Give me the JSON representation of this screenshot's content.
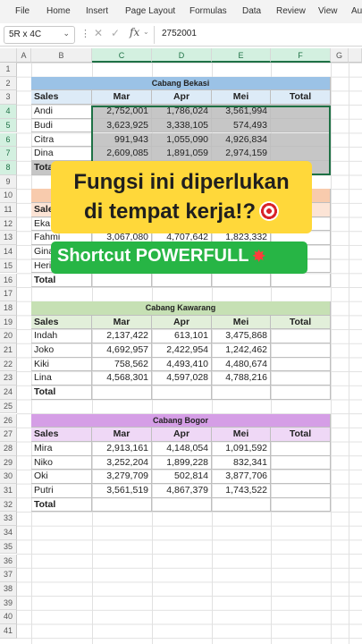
{
  "ribbon": {
    "tabs": [
      "File",
      "Home",
      "Insert",
      "Page Layout",
      "Formulas",
      "Data",
      "Review",
      "View",
      "Au"
    ]
  },
  "formula_bar": {
    "name_box": "5R x 4C",
    "fx": "fx",
    "value": "2752001"
  },
  "columns": [
    "A",
    "B",
    "C",
    "D",
    "E",
    "F",
    "G"
  ],
  "rows": [
    "1",
    "2",
    "3",
    "4",
    "5",
    "6",
    "7",
    "8",
    "9",
    "10",
    "11",
    "12",
    "13",
    "14",
    "15",
    "16",
    "17",
    "18",
    "19",
    "20",
    "21",
    "22",
    "23",
    "24",
    "25",
    "26",
    "27",
    "28",
    "29",
    "30",
    "31",
    "32",
    "33",
    "34",
    "35",
    "36",
    "37",
    "38",
    "39",
    "40",
    "41"
  ],
  "colors": {
    "bekasi": "#9bc2e6",
    "bekasi_hdr": "#ddebf7",
    "cikarang": "#f8cbad",
    "cikarang_hdr": "#fce4d6",
    "kawarang": "#c6e0b4",
    "kawarang_hdr": "#e2efda",
    "bogor": "#d59ee6",
    "bogor_hdr": "#efd8f6",
    "selection": "#1e7145",
    "selected_fill": "#c6c6c6"
  },
  "tables": [
    {
      "id": "bekasi",
      "title": "Cabang Bekasi",
      "headers": [
        "Sales",
        "Mar",
        "Apr",
        "Mei",
        "Total"
      ],
      "rows": [
        [
          "Andi",
          "2,752,001",
          "1,786,024",
          "3,561,994",
          ""
        ],
        [
          "Budi",
          "3,623,925",
          "3,338,105",
          "574,493",
          ""
        ],
        [
          "Citra",
          "991,943",
          "1,055,090",
          "4,926,834",
          ""
        ],
        [
          "Dina",
          "2,609,085",
          "1,891,059",
          "2,974,159",
          ""
        ]
      ],
      "total": "Total"
    },
    {
      "id": "cikarang",
      "title": "",
      "headers": [
        "Sale",
        "",
        "",
        "",
        ""
      ],
      "rows": [
        [
          "Eka",
          "",
          "",
          "",
          ""
        ],
        [
          "Fahmi",
          "3,067,080",
          "4,707,642",
          "1,823,332",
          ""
        ],
        [
          "Gina",
          "",
          "",
          "",
          ""
        ],
        [
          "Heri",
          "",
          "",
          "",
          ""
        ]
      ],
      "total": "Total"
    },
    {
      "id": "kawarang",
      "title": "Cabang Kawarang",
      "headers": [
        "Sales",
        "Mar",
        "Apr",
        "Mei",
        "Total"
      ],
      "rows": [
        [
          "Indah",
          "2,137,422",
          "613,101",
          "3,475,868",
          ""
        ],
        [
          "Joko",
          "4,692,957",
          "2,422,954",
          "1,242,462",
          ""
        ],
        [
          "Kiki",
          "758,562",
          "4,493,410",
          "4,480,674",
          ""
        ],
        [
          "Lina",
          "4,568,301",
          "4,597,028",
          "4,788,216",
          ""
        ]
      ],
      "total": "Total"
    },
    {
      "id": "bogor",
      "title": "Cabang Bogor",
      "headers": [
        "Sales",
        "Mar",
        "Apr",
        "Mei",
        "Total"
      ],
      "rows": [
        [
          "Mira",
          "2,913,161",
          "4,148,054",
          "1,091,592",
          ""
        ],
        [
          "Niko",
          "3,252,204",
          "1,899,228",
          "832,341",
          ""
        ],
        [
          "Oki",
          "3,279,709",
          "502,814",
          "3,877,706",
          ""
        ],
        [
          "Putri",
          "3,561,519",
          "4,867,379",
          "1,743,522",
          ""
        ]
      ],
      "total": "Total"
    }
  ],
  "overlay": {
    "line1": "Fungsi ini diperlukan",
    "line2": "di tempat kerja!?",
    "line2_emoji": "target-emoji",
    "line3": "Shortcut POWERFULL",
    "line3_emoji": "collision-emoji"
  }
}
